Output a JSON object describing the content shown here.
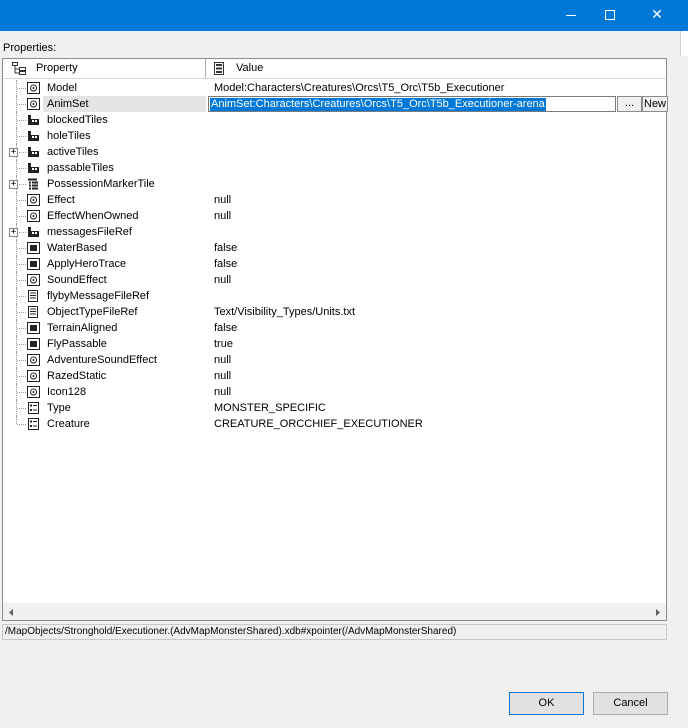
{
  "window": {
    "minimize_icon": "minimize-icon",
    "maximize_icon": "maximize-icon",
    "close_glyph": "✕"
  },
  "properties_label": "Properties:",
  "grid": {
    "header": {
      "property": "Property",
      "value": "Value"
    },
    "rows": [
      {
        "name": "Model",
        "value": "Model:Characters\\Creatures\\Orcs\\T5_Orc\\T5b_Executioner",
        "icon": "object-ref-icon",
        "expander": ""
      },
      {
        "name": "AnimSet",
        "value": "AnimSet:Characters\\Creatures\\Orcs\\T5_Orc\\T5b_Executioner-arena",
        "icon": "object-ref-icon",
        "expander": "",
        "selected": true
      },
      {
        "name": "blockedTiles",
        "value": "",
        "icon": "array-icon",
        "expander": ""
      },
      {
        "name": "holeTiles",
        "value": "",
        "icon": "array-icon",
        "expander": ""
      },
      {
        "name": "activeTiles",
        "value": "",
        "icon": "array-icon",
        "expander": "+"
      },
      {
        "name": "passableTiles",
        "value": "",
        "icon": "array-icon",
        "expander": ""
      },
      {
        "name": "PossessionMarkerTile",
        "value": "",
        "icon": "struct-icon",
        "expander": "+"
      },
      {
        "name": "Effect",
        "value": "null",
        "icon": "object-ref-icon",
        "expander": ""
      },
      {
        "name": "EffectWhenOwned",
        "value": "null",
        "icon": "object-ref-icon",
        "expander": ""
      },
      {
        "name": "messagesFileRef",
        "value": "",
        "icon": "array-icon",
        "expander": "+"
      },
      {
        "name": "WaterBased",
        "value": "false",
        "icon": "bool-icon",
        "expander": ""
      },
      {
        "name": "ApplyHeroTrace",
        "value": "false",
        "icon": "bool-icon",
        "expander": ""
      },
      {
        "name": "SoundEffect",
        "value": "null",
        "icon": "object-ref-icon",
        "expander": ""
      },
      {
        "name": "flybyMessageFileRef",
        "value": "",
        "icon": "file-ref-icon",
        "expander": ""
      },
      {
        "name": "ObjectTypeFileRef",
        "value": "Text/Visibility_Types/Units.txt",
        "icon": "file-ref-icon",
        "expander": ""
      },
      {
        "name": "TerrainAligned",
        "value": "false",
        "icon": "bool-icon",
        "expander": ""
      },
      {
        "name": "FlyPassable",
        "value": "true",
        "icon": "bool-icon",
        "expander": ""
      },
      {
        "name": "AdventureSoundEffect",
        "value": "null",
        "icon": "object-ref-icon",
        "expander": ""
      },
      {
        "name": "RazedStatic",
        "value": "null",
        "icon": "object-ref-icon",
        "expander": ""
      },
      {
        "name": "Icon128",
        "value": "null",
        "icon": "object-ref-icon",
        "expander": ""
      },
      {
        "name": "Type",
        "value": "MONSTER_SPECIFIC",
        "icon": "enum-icon",
        "expander": ""
      },
      {
        "name": "Creature",
        "value": "CREATURE_ORCCHIEF_EXECUTIONER",
        "icon": "enum-icon",
        "expander": ""
      }
    ],
    "editor_buttons": {
      "browse": "...",
      "new": "New"
    }
  },
  "path": "/MapObjects/Stronghold/Executioner.(AdvMapMonsterShared).xdb#xpointer(/AdvMapMonsterShared)",
  "buttons": {
    "ok": "OK",
    "cancel": "Cancel"
  },
  "colors": {
    "titlebar": "#0078d7",
    "selection": "#0078d7"
  }
}
